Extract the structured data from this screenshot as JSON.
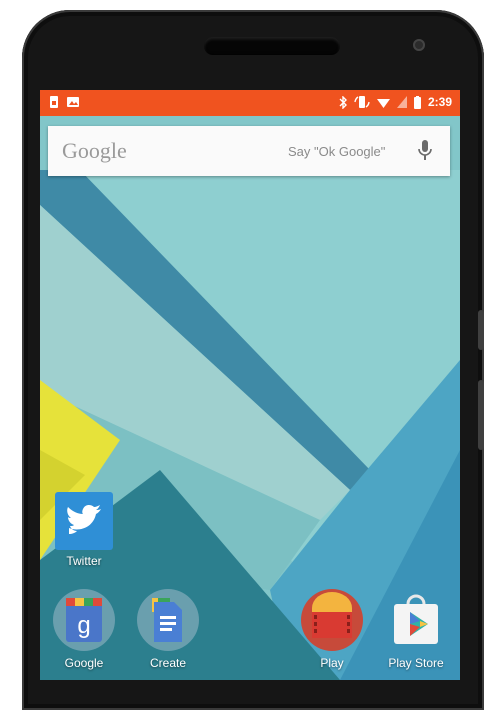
{
  "status_bar": {
    "time": "2:39",
    "icons": [
      "sim-icon",
      "photo-icon",
      "bluetooth-icon",
      "rotate-icon",
      "wifi-icon",
      "signal-icon",
      "battery-icon"
    ]
  },
  "search": {
    "logo": "Google",
    "hint": "Say \"Ok Google\""
  },
  "apps": [
    {
      "label": "Twitter",
      "icon": "twitter-icon"
    },
    {
      "label": "Google",
      "icon": "google-icon"
    },
    {
      "label": "Create",
      "icon": "docs-icon"
    },
    {
      "label": "Play",
      "icon": "play-movies-icon"
    },
    {
      "label": "Play Store",
      "icon": "play-store-icon"
    }
  ],
  "colors": {
    "status_bar": "#f0531f",
    "wallpaper_base": "#82c6c9",
    "accent_yellow": "#e6e23a",
    "twitter_blue": "#2f8fd6"
  }
}
